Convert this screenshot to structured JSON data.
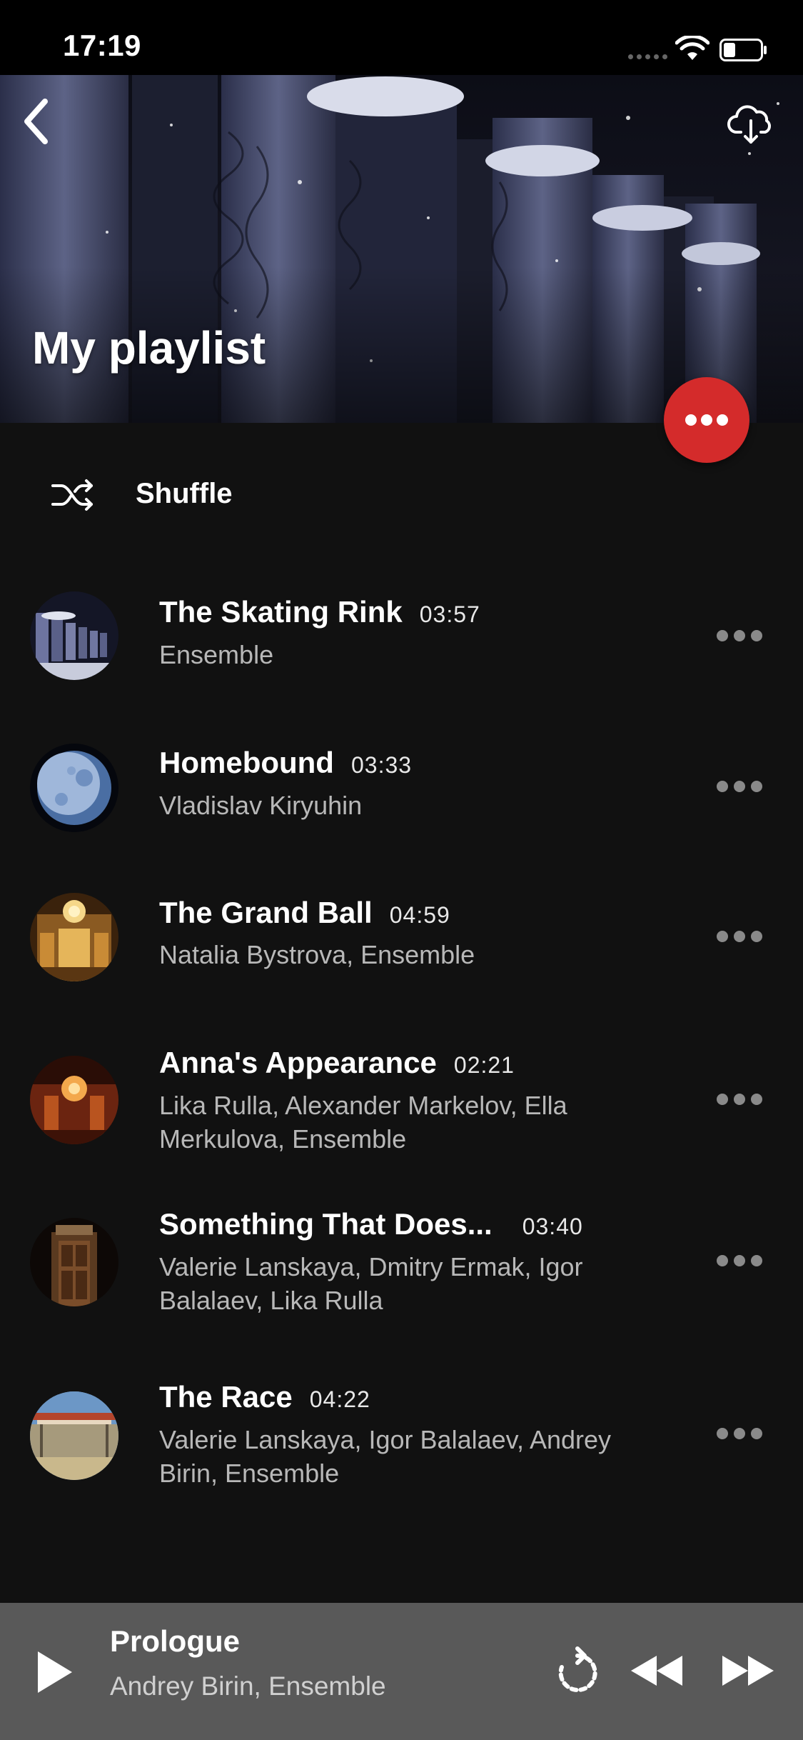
{
  "status_bar": {
    "time": "17:19"
  },
  "header": {
    "title": "My playlist"
  },
  "shuffle": {
    "label": "Shuffle"
  },
  "tracks": [
    {
      "title": "The Skating Rink",
      "duration": "03:57",
      "artists": "Ensemble"
    },
    {
      "title": "Homebound",
      "duration": "03:33",
      "artists": "Vladislav Kiryuhin"
    },
    {
      "title": "The Grand Ball",
      "duration": "04:59",
      "artists": "Natalia Bystrova, Ensemble"
    },
    {
      "title": "Anna's Appearance",
      "duration": "02:21",
      "artists": "Lika Rulla, Alexander Markelov, Ella Merkulova, Ensemble"
    },
    {
      "title": "Something That Does...",
      "duration": "03:40",
      "artists": "Valerie Lanskaya, Dmitry Ermak, Igor Balalaev, Lika Rulla"
    },
    {
      "title": "The Race",
      "duration": "04:22",
      "artists": "Valerie Lanskaya, Igor Balalaev, Andrey Birin, Ensemble"
    }
  ],
  "now_playing": {
    "title": "Prologue",
    "artists": "Andrey Birin, Ensemble"
  },
  "colors": {
    "accent": "#d42b2b",
    "background": "#111111",
    "mini_player": "#595959"
  },
  "icons": [
    "back-icon",
    "cloud-download-icon",
    "more-icon",
    "shuffle-icon",
    "play-icon",
    "replay-icon",
    "rewind-icon",
    "fast-forward-icon"
  ]
}
